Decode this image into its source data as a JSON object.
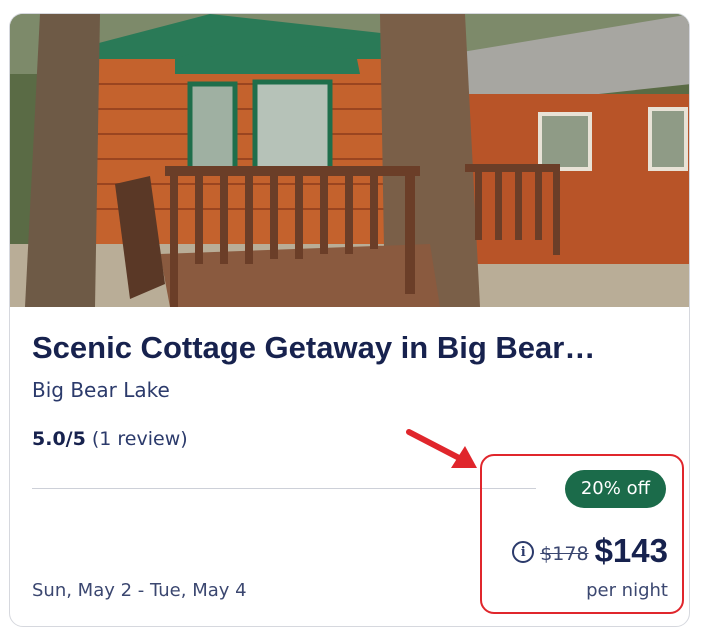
{
  "listing": {
    "title": "Scenic Cottage Getaway in Big Bear…",
    "location": "Big Bear Lake",
    "rating_score": "5.0/5",
    "rating_reviews": "(1 review)",
    "dates": "Sun, May 2 - Tue, May 4"
  },
  "pricing": {
    "discount_badge": "20% off",
    "info_icon": "info-circle-icon",
    "original_price": "$178",
    "current_price": "$143",
    "unit": "per night"
  },
  "colors": {
    "title": "#17224e",
    "badge": "#1b6b4a",
    "highlight_box": "#e0262c",
    "arrow": "#e0262c"
  },
  "icons": {
    "annotation": "red-arrow-icon",
    "photo_subject": "log-cabin-photo"
  }
}
